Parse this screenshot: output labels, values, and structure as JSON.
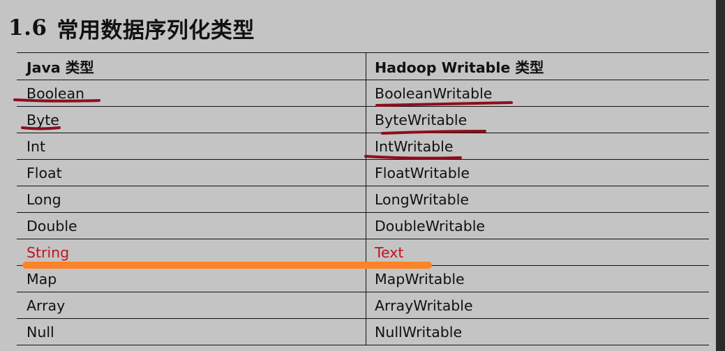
{
  "section": {
    "number": "1.6",
    "title": "常用数据序列化类型"
  },
  "table": {
    "headers": [
      "Java 类型",
      "Hadoop Writable 类型"
    ],
    "rows": [
      [
        "Boolean",
        "BooleanWritable"
      ],
      [
        "Byte",
        "ByteWritable"
      ],
      [
        "Int",
        "IntWritable"
      ],
      [
        "Float",
        "FloatWritable"
      ],
      [
        "Long",
        "LongWritable"
      ],
      [
        "Double",
        "DoubleWritable"
      ],
      [
        "String",
        "Text"
      ],
      [
        "Map",
        "MapWritable"
      ],
      [
        "Array",
        "ArrayWritable"
      ],
      [
        "Null",
        "NullWritable"
      ]
    ],
    "highlighted_row": 6
  },
  "colors": {
    "background": "#c4c4c4",
    "text": "#111111",
    "highlight_text": "#c0141c",
    "underline_marker": "#8e0e1e",
    "orange_marker": "#ff8226"
  }
}
